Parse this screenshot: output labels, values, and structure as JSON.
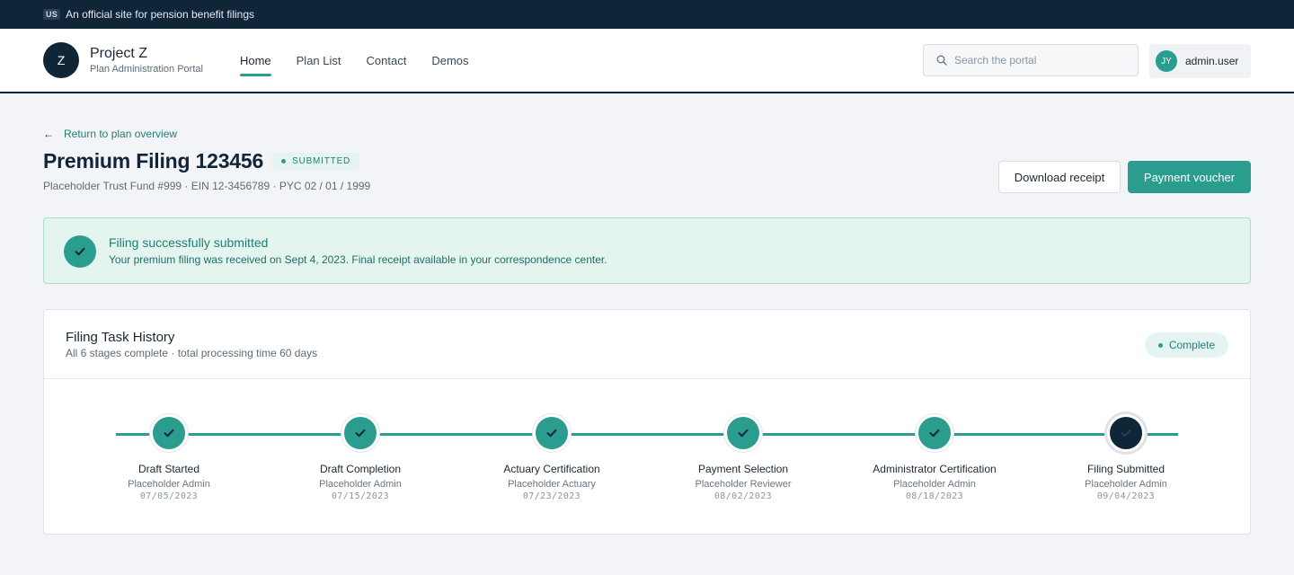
{
  "banner": {
    "badge": "US",
    "text": "An official site for pension benefit filings"
  },
  "brand": {
    "logo_letter": "Z",
    "name": "Project Z",
    "subtitle": "Plan Administration Portal"
  },
  "nav": {
    "items": [
      {
        "label": "Home",
        "active": true
      },
      {
        "label": "Plan List",
        "active": false
      },
      {
        "label": "Contact",
        "active": false
      },
      {
        "label": "Demos",
        "active": false
      }
    ]
  },
  "search": {
    "placeholder": "Search the portal",
    "value": ""
  },
  "user": {
    "initials": "JY",
    "name": "admin.user"
  },
  "page": {
    "back_link": "Return to plan overview",
    "title": "Premium Filing 123456",
    "status": "SUBMITTED",
    "meta": "Placeholder Trust Fund #999 · EIN 12-3456789 · PYC 02 / 01 / 1999"
  },
  "actions": {
    "download_receipt": "Download receipt",
    "payment_voucher": "Payment voucher"
  },
  "alert": {
    "title": "Filing successfully submitted",
    "body": "Your premium filing was received on Sept 4, 2023. Final receipt available in your correspondence center."
  },
  "history": {
    "title": "Filing Task History",
    "subtitle": "All 6 stages complete · total processing time 60 days",
    "status": "Complete",
    "steps": [
      {
        "label": "Draft Started",
        "person": "Placeholder Admin",
        "date": "07/05/2023",
        "state": "done"
      },
      {
        "label": "Draft Completion",
        "person": "Placeholder Admin",
        "date": "07/15/2023",
        "state": "done"
      },
      {
        "label": "Actuary Certification",
        "person": "Placeholder Actuary",
        "date": "07/23/2023",
        "state": "done"
      },
      {
        "label": "Payment Selection",
        "person": "Placeholder Reviewer",
        "date": "08/02/2023",
        "state": "done"
      },
      {
        "label": "Administrator Certification",
        "person": "Placeholder Admin",
        "date": "08/18/2023",
        "state": "done"
      },
      {
        "label": "Filing Submitted",
        "person": "Placeholder Admin",
        "date": "09/04/2023",
        "state": "final"
      }
    ]
  },
  "colors": {
    "accent": "#2a9d8f",
    "navy": "#0f2538",
    "success_bg": "#e4f4ef"
  },
  "icons": {
    "search": "search-icon",
    "back": "arrow-left-icon",
    "check": "check-icon"
  }
}
